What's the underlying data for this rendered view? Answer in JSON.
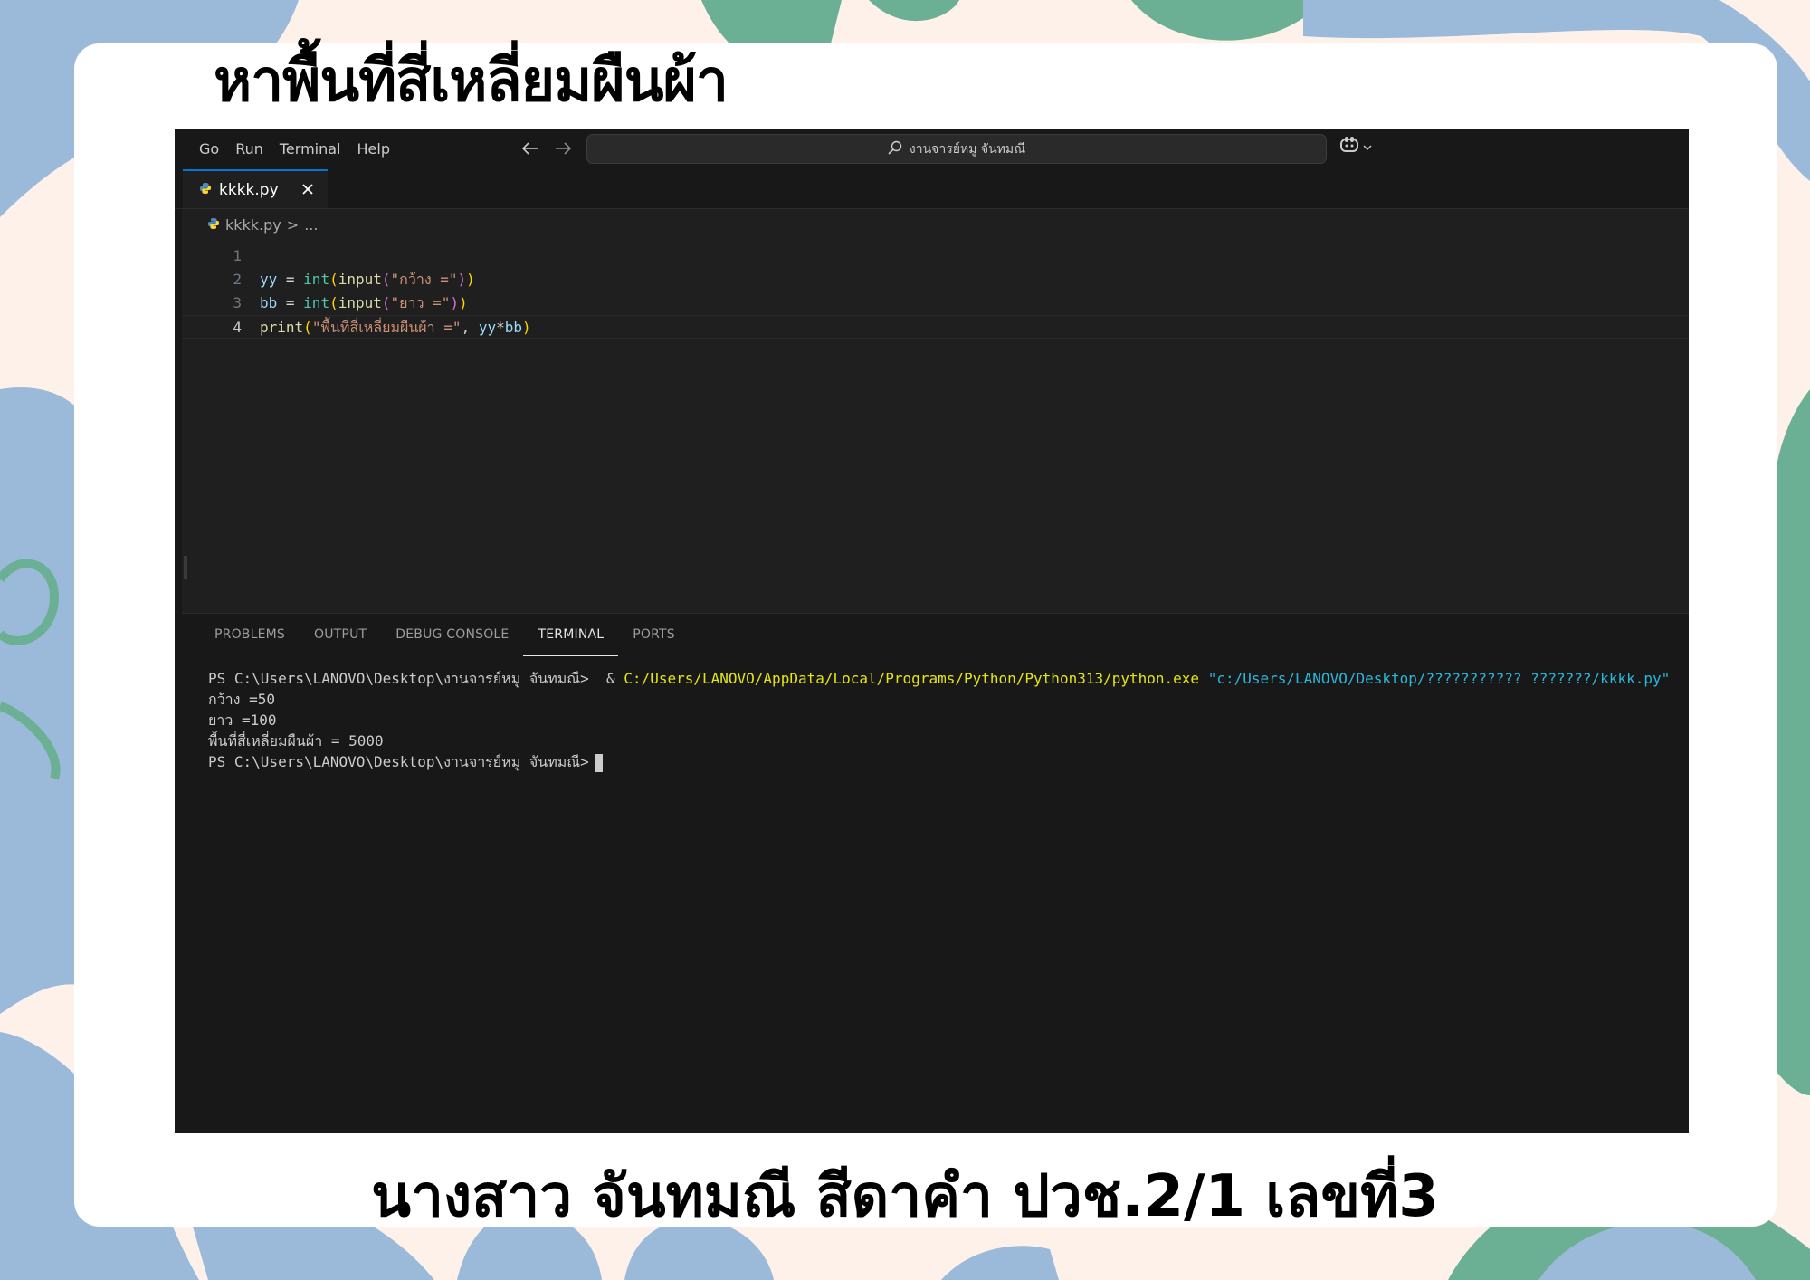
{
  "slide": {
    "title": "หาพื้นที่สี่เหลี่ยมผืนผ้า",
    "footer": "นางสาว จันทมณี สีดาคำ ปวช.2/1 เลขที่3"
  },
  "window": {
    "menu": [
      "Go",
      "Run",
      "Terminal",
      "Help"
    ],
    "search_text": "งานจารย์หมู จันทมณี",
    "icons": {
      "back": "arrow-left-icon",
      "forward": "arrow-right-icon",
      "search": "search-icon",
      "copilot": "copilot-icon",
      "dropdown": "chevron-down-icon"
    }
  },
  "tab": {
    "label": "kkkk.py",
    "close_glyph": "✕"
  },
  "breadcrumb": {
    "file": "kkkk.py",
    "sep": ">",
    "rest": "..."
  },
  "editor": {
    "line_numbers": [
      "1",
      "2",
      "3",
      "4"
    ],
    "active_line": "4",
    "lines": [
      {
        "text": ""
      },
      {
        "var": "yy",
        "eq": " = ",
        "builtin": "int",
        "p1": "(",
        "fn": "input",
        "p2": "(",
        "str": "\"กว้าง =\"",
        "p2c": ")",
        "p1c": ")"
      },
      {
        "var": "bb",
        "eq": " = ",
        "builtin": "int",
        "p1": "(",
        "fn": "input",
        "p2": "(",
        "str": "\"ยาว =\"",
        "p2c": ")",
        "p1c": ")"
      },
      {
        "fn": "print",
        "p1": "(",
        "str": "\"พื้นที่สี่เหลี่ยมผืนผ้า =\"",
        "comma": ", ",
        "var1": "yy",
        "op": "*",
        "var2": "bb",
        "p1c": ")"
      }
    ]
  },
  "panel": {
    "tabs": [
      "PROBLEMS",
      "OUTPUT",
      "DEBUG CONSOLE",
      "TERMINAL",
      "PORTS"
    ],
    "active_tab": "TERMINAL"
  },
  "terminal": {
    "line1_prompt": "PS C:\\Users\\LANOVO\\Desktop\\งานจารย์หมู จันทมณี>",
    "line1_amp": "  & ",
    "line1_exe": "C:/Users/LANOVO/AppData/Local/Programs/Python/Python313/python.exe",
    "line1_arg": "\"c:/Users/LANOVO/Desktop/??????????? ???????/kkkk.py\"",
    "line2": "กว้าง =50",
    "line3": "ยาว =100",
    "line4": "พื้นที่สี่เหลี่ยมผืนผ้า = 5000",
    "line5_prompt": "PS C:\\Users\\LANOVO\\Desktop\\งานจารย์หมู จันทมณี>"
  },
  "colors": {
    "background_blue": "#9bbad9",
    "background_green": "#6bb094",
    "background_cream": "#fdf1ea",
    "editor_bg": "#1f1f1f",
    "accent": "#0078d4"
  }
}
